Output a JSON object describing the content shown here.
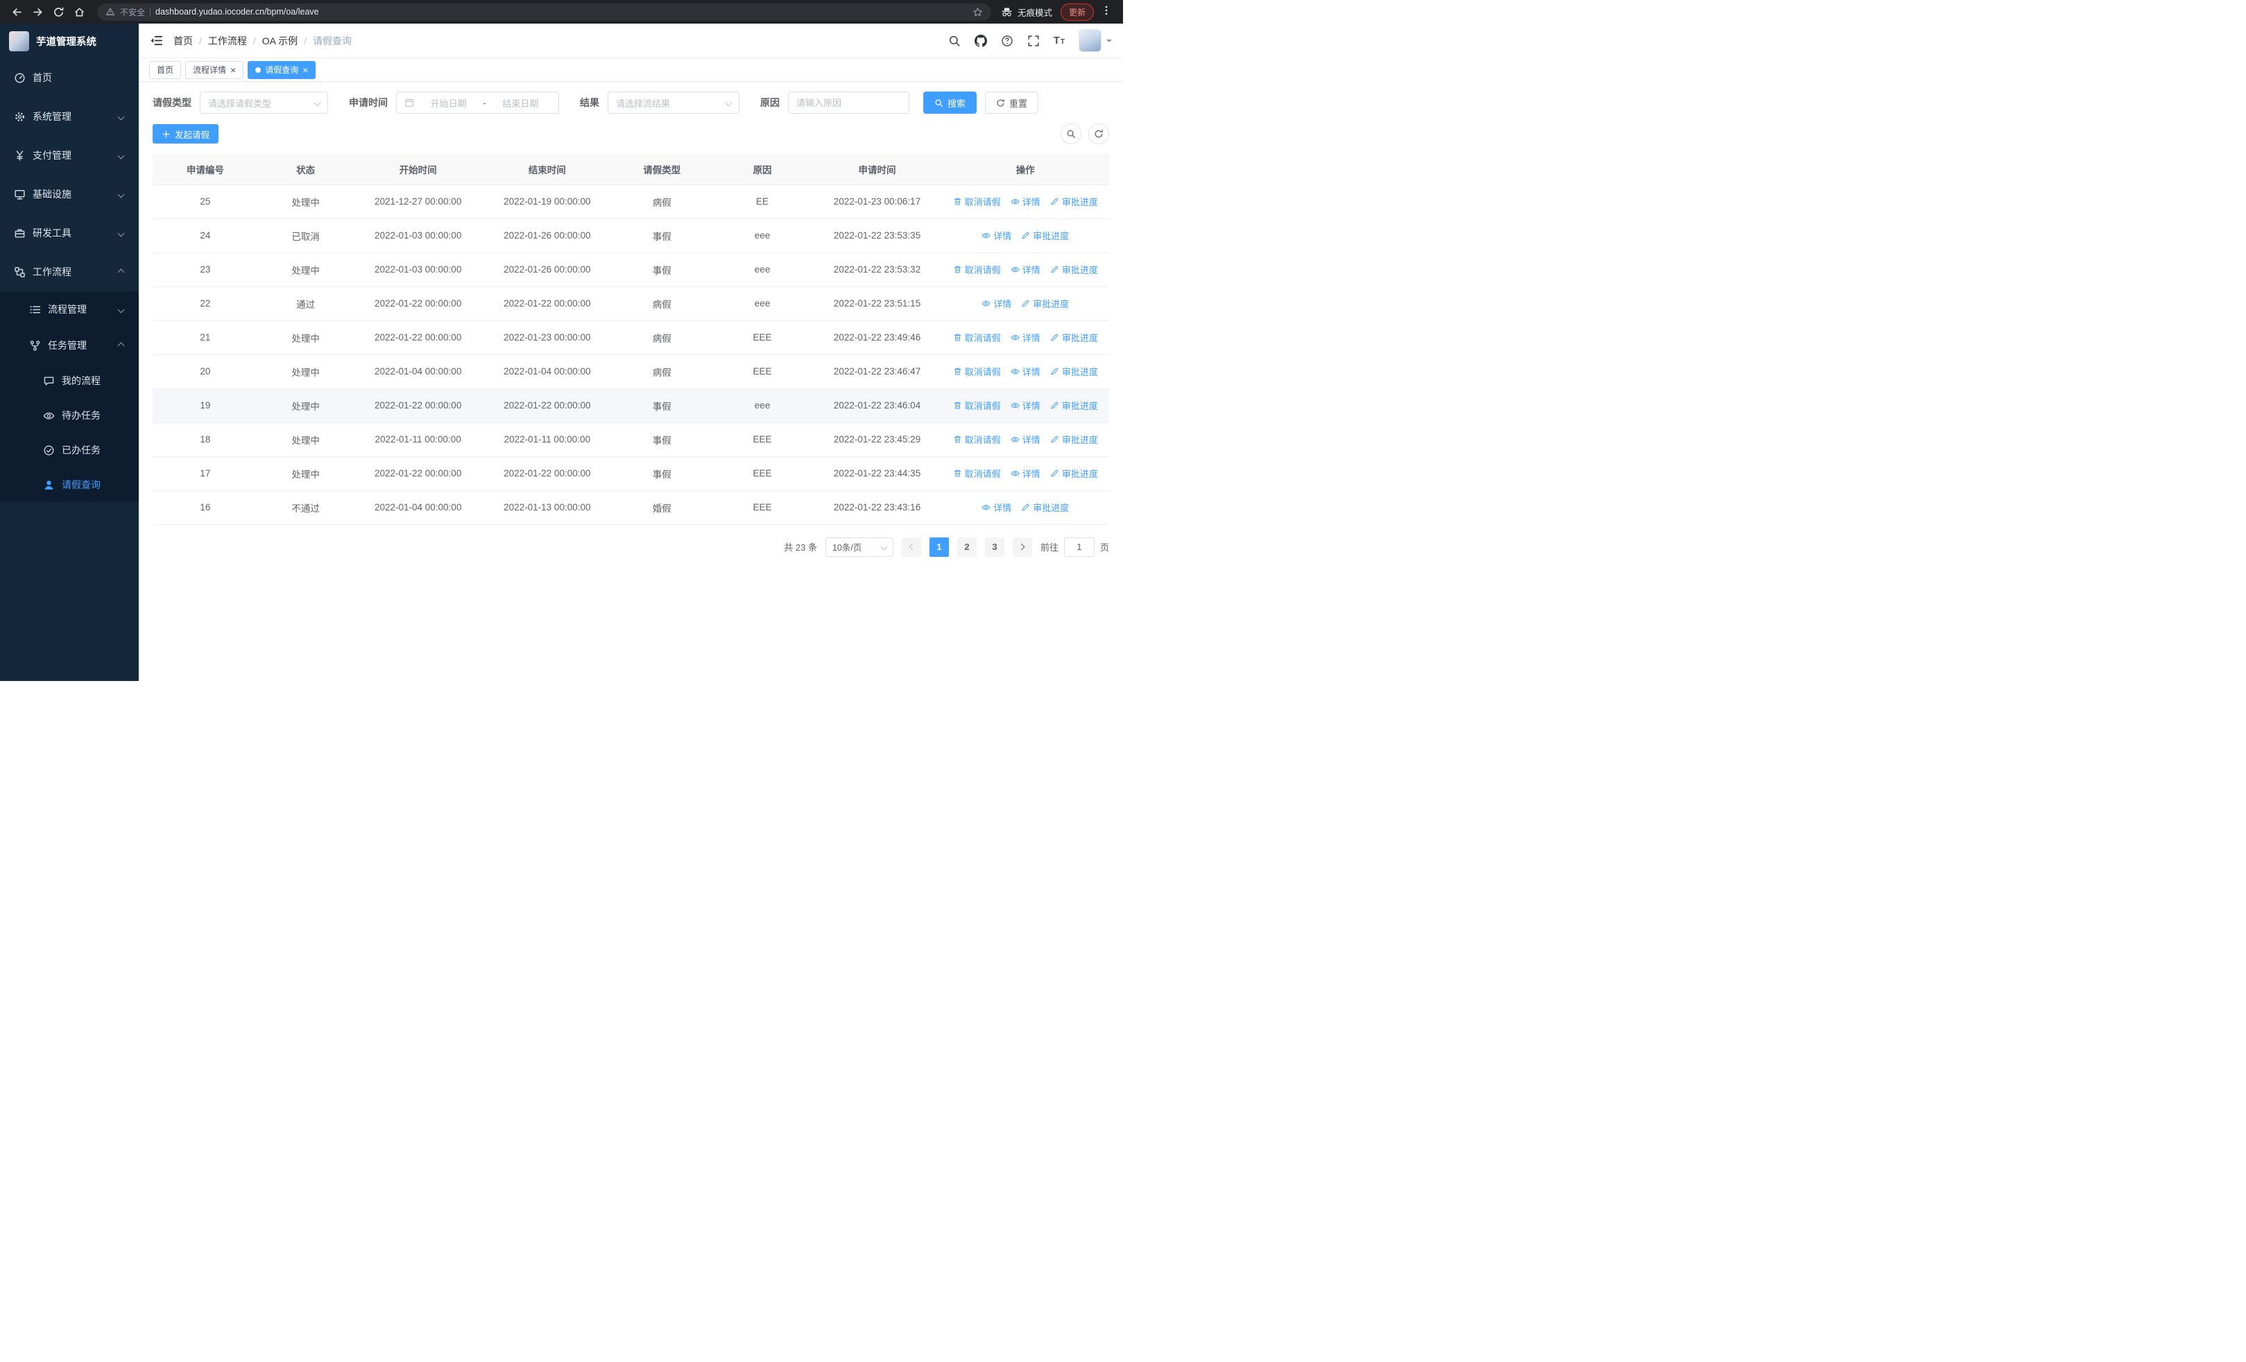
{
  "colors": {
    "primary": "#409eff",
    "sidebar_bg": "#14273b",
    "sidebar_submenu_bg": "#0d1c2e",
    "active_tab_bg": "#409eff"
  },
  "browser": {
    "security_label": "不安全",
    "url": "dashboard.yudao.iocoder.cn/bpm/oa/leave",
    "incognito_label": "无痕模式",
    "update_label": "更新"
  },
  "sidebar": {
    "logo_title": "芋道管理系统",
    "items": [
      {
        "label": "首页",
        "icon": "dashboard-icon"
      },
      {
        "label": "系统管理",
        "icon": "gear-icon"
      },
      {
        "label": "支付管理",
        "icon": "yen-icon"
      },
      {
        "label": "基础设施",
        "icon": "infrastructure-icon"
      },
      {
        "label": "研发工具",
        "icon": "tools-icon"
      },
      {
        "label": "工作流程",
        "icon": "workflow-icon",
        "children": [
          {
            "label": "流程管理",
            "icon": "process-list-icon"
          },
          {
            "label": "任务管理",
            "icon": "task-fork-icon",
            "children": [
              {
                "label": "我的流程",
                "icon": "chat-icon"
              },
              {
                "label": "待办任务",
                "icon": "eye-icon"
              },
              {
                "label": "已办任务",
                "icon": "done-check-icon"
              },
              {
                "label": "请假查询",
                "icon": "user-icon"
              }
            ]
          }
        ]
      }
    ]
  },
  "header": {
    "breadcrumb": [
      "首页",
      "工作流程",
      "OA 示例",
      "请假查询"
    ],
    "separator": "/",
    "icons": [
      "search-icon",
      "github-icon",
      "help-icon",
      "fullscreen-icon",
      "font-size-icon",
      "avatar"
    ]
  },
  "tabs": [
    {
      "label": "首页",
      "closable": false,
      "active": false
    },
    {
      "label": "流程详情",
      "closable": true,
      "active": false
    },
    {
      "label": "请假查询",
      "closable": true,
      "active": true
    }
  ],
  "filters": {
    "leave_type_label": "请假类型",
    "leave_type_placeholder": "请选择请假类型",
    "apply_time_label": "申请时间",
    "start_date_placeholder": "开始日期",
    "range_separator": "-",
    "end_date_placeholder": "结束日期",
    "result_label": "结果",
    "result_placeholder": "请选择流结果",
    "reason_label": "原因",
    "reason_placeholder": "请输入原因",
    "search_button": "搜索",
    "reset_button": "重置"
  },
  "toolbar": {
    "create_button": "发起请假"
  },
  "table": {
    "columns": [
      "申请编号",
      "状态",
      "开始时间",
      "结束时间",
      "请假类型",
      "原因",
      "申请时间",
      "操作"
    ],
    "actions": {
      "cancel": "取消请假",
      "detail": "详情",
      "progress": "审批进度"
    },
    "rows": [
      {
        "id": "25",
        "status": "处理中",
        "start": "2021-12-27 00:00:00",
        "end": "2022-01-19 00:00:00",
        "type": "病假",
        "reason": "EE",
        "applied": "2022-01-23 00:06:17",
        "cancellable": true,
        "highlighted": false
      },
      {
        "id": "24",
        "status": "已取消",
        "start": "2022-01-03 00:00:00",
        "end": "2022-01-26 00:00:00",
        "type": "事假",
        "reason": "eee",
        "applied": "2022-01-22 23:53:35",
        "cancellable": false,
        "highlighted": false
      },
      {
        "id": "23",
        "status": "处理中",
        "start": "2022-01-03 00:00:00",
        "end": "2022-01-26 00:00:00",
        "type": "事假",
        "reason": "eee",
        "applied": "2022-01-22 23:53:32",
        "cancellable": true,
        "highlighted": false
      },
      {
        "id": "22",
        "status": "通过",
        "start": "2022-01-22 00:00:00",
        "end": "2022-01-22 00:00:00",
        "type": "病假",
        "reason": "eee",
        "applied": "2022-01-22 23:51:15",
        "cancellable": false,
        "highlighted": false
      },
      {
        "id": "21",
        "status": "处理中",
        "start": "2022-01-22 00:00:00",
        "end": "2022-01-23 00:00:00",
        "type": "病假",
        "reason": "EEE",
        "applied": "2022-01-22 23:49:46",
        "cancellable": true,
        "highlighted": false
      },
      {
        "id": "20",
        "status": "处理中",
        "start": "2022-01-04 00:00:00",
        "end": "2022-01-04 00:00:00",
        "type": "病假",
        "reason": "EEE",
        "applied": "2022-01-22 23:46:47",
        "cancellable": true,
        "highlighted": false
      },
      {
        "id": "19",
        "status": "处理中",
        "start": "2022-01-22 00:00:00",
        "end": "2022-01-22 00:00:00",
        "type": "事假",
        "reason": "eee",
        "applied": "2022-01-22 23:46:04",
        "cancellable": true,
        "highlighted": true
      },
      {
        "id": "18",
        "status": "处理中",
        "start": "2022-01-11 00:00:00",
        "end": "2022-01-11 00:00:00",
        "type": "事假",
        "reason": "EEE",
        "applied": "2022-01-22 23:45:29",
        "cancellable": true,
        "highlighted": false
      },
      {
        "id": "17",
        "status": "处理中",
        "start": "2022-01-22 00:00:00",
        "end": "2022-01-22 00:00:00",
        "type": "事假",
        "reason": "EEE",
        "applied": "2022-01-22 23:44:35",
        "cancellable": true,
        "highlighted": false
      },
      {
        "id": "16",
        "status": "不通过",
        "start": "2022-01-04 00:00:00",
        "end": "2022-01-13 00:00:00",
        "type": "婚假",
        "reason": "EEE",
        "applied": "2022-01-22 23:43:16",
        "cancellable": false,
        "highlighted": false
      }
    ]
  },
  "pagination": {
    "total_label": "共 23 条",
    "page_size": "10条/页",
    "pages": [
      "1",
      "2",
      "3"
    ],
    "active_page": "1",
    "goto_label": "前往",
    "goto_value": "1",
    "page_unit": "页"
  }
}
